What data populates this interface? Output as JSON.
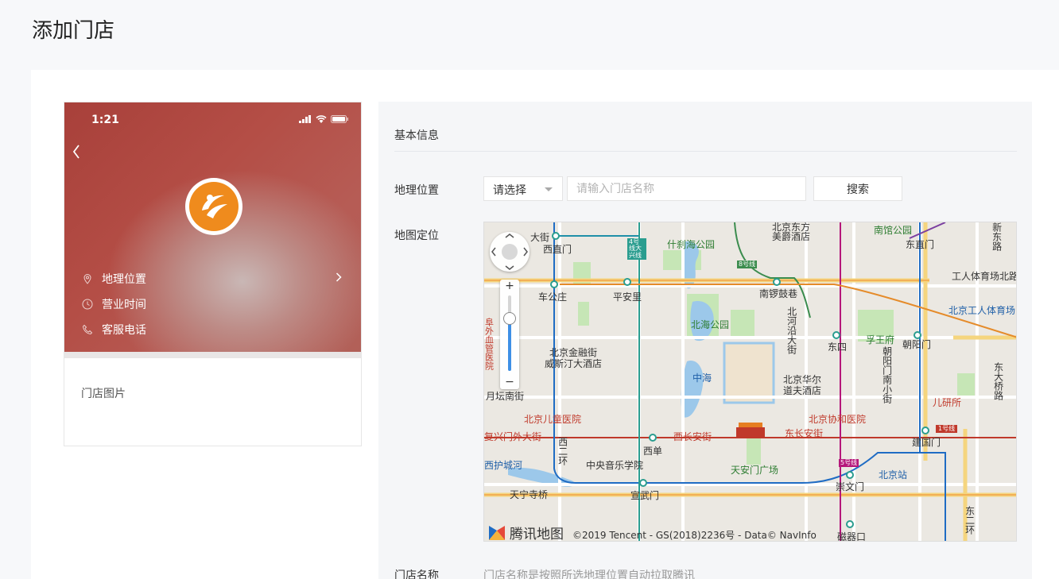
{
  "page": {
    "title": "添加门店"
  },
  "phone_preview": {
    "status_time": "1:21",
    "rows": [
      {
        "icon": "location-pin-icon",
        "label": "地理位置"
      },
      {
        "icon": "clock-icon",
        "label": "营业时间"
      },
      {
        "icon": "phone-icon",
        "label": "客服电话"
      }
    ],
    "images_label": "门店图片",
    "colors": {
      "accent": "#ef8b1d",
      "hero": "#b04a42"
    }
  },
  "form": {
    "section_title": "基本信息",
    "geo_label": "地理位置",
    "select_value": "请选择",
    "search_placeholder": "请输入门店名称",
    "search_button": "搜索",
    "map_label": "地图定位",
    "store_name_label": "门店名称",
    "store_name_hint": "门店名称是按照所选地理位置自动拉取腾讯"
  },
  "map": {
    "brand": "腾讯地图",
    "copyright": "©2019 Tencent - GS(2018)2236号 - Data© NavInfo",
    "zoom_plus": "+",
    "zoom_minus": "−",
    "zoom_level": 0.7,
    "labels": {
      "l1": "北京东方",
      "l2": "美爵酒店",
      "l3": "南馆公园",
      "l4": "东直门",
      "l5": "新东路",
      "l6": "大街",
      "l7": "西直门",
      "l8": "什刹海公园",
      "l9": "工人体育场北路",
      "l10": "车公庄",
      "l11": "平安里",
      "l12": "南锣鼓巷",
      "l13": "北京工人体育场",
      "l14": "北海公园",
      "l15": "北河沿大街",
      "l16": "孚王府",
      "l17": "朝阳门",
      "l18": "东四",
      "l19": "北京金融街",
      "l20": "威斯汀大酒店",
      "l21": "朝阳门南小街",
      "l22": "中海",
      "l23": "北京华尔",
      "l24": "道夫酒店",
      "l25": "东大桥路",
      "l26": "月坛南街",
      "l27": "儿研所",
      "l28": "北京儿童医院",
      "l29": "北京协和医院",
      "l30": "复兴门外大街",
      "l31": "西长安街",
      "l32": "东长安街",
      "l33": "建国门",
      "l34": "西单",
      "l35": "西二环",
      "l36": "中央音乐学院",
      "l37": "天安门广场",
      "l38": "北京站",
      "l39": "西护城河",
      "l40": "天宁寺桥",
      "l41": "宣武门",
      "l42": "崇文门",
      "l43": "磁器口",
      "l44": "东二环",
      "l45": "阜外血管医院",
      "l46": "4号线大兴线",
      "l47": "8号线",
      "l48": "5号线",
      "l49": "1号线"
    }
  }
}
